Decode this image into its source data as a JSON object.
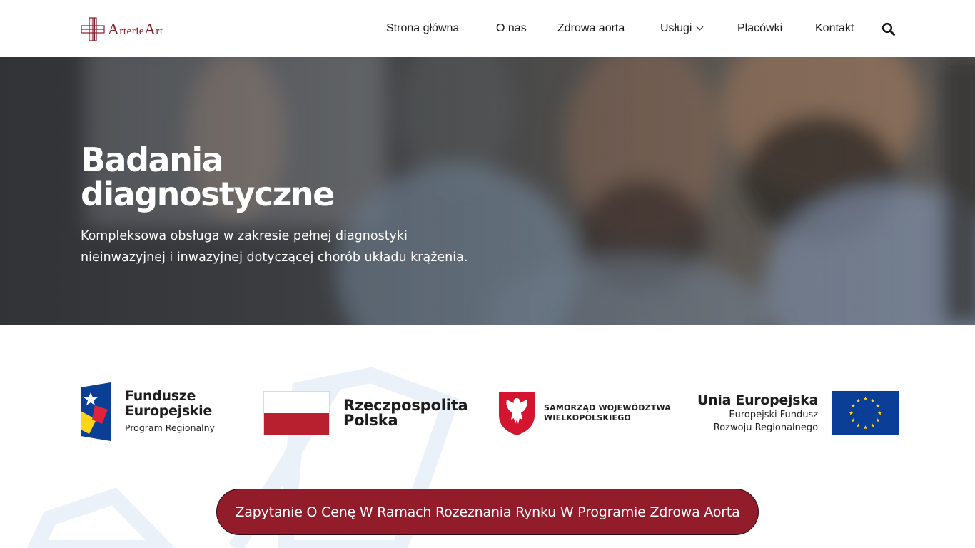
{
  "header": {
    "logo_text_parts": [
      "A",
      "rterie",
      "A",
      "rt"
    ],
    "logo_alt": "ArterieArt",
    "nav": [
      {
        "label": "Strona główna"
      },
      {
        "label": "O nas"
      },
      {
        "label": "Zdrowa aorta"
      },
      {
        "label": "Usługi",
        "has_dropdown": true
      },
      {
        "label": "Placówki"
      },
      {
        "label": "Kontakt"
      }
    ],
    "search_icon": "search-icon"
  },
  "hero": {
    "title_line1": "Badania",
    "title_line2": "diagnostyczne",
    "subtitle_line1": "Kompleksowa obsługa w zakresie pełnej diagnostyki",
    "subtitle_line2": "nieinwazyjnej i inwazyjnej dotyczącej chorób układu krążenia."
  },
  "funding": {
    "fundusze": {
      "line1": "Fundusze",
      "line2": "Europejskie",
      "line3": "Program Regionalny"
    },
    "rzeczpospolita": {
      "line1": "Rzeczpospolita",
      "line2": "Polska"
    },
    "samorzad": {
      "line1": "SAMORZĄD WOJEWÓDZTWA",
      "line2": "WIELKOPOLSKIEGO"
    },
    "unia": {
      "line1": "Unia Europejska",
      "line2": "Europejski Fundusz",
      "line3": "Rozwoju Regionalnego"
    }
  },
  "cta": {
    "label": "Zapytanie O Cenę W Ramach Rozeznania Rynku W Programie Zdrowa Aorta"
  },
  "colors": {
    "brand": "#931c2b",
    "eu_blue": "#0b3f97",
    "eu_star": "#ffd617",
    "pl_red": "#b8202f"
  }
}
